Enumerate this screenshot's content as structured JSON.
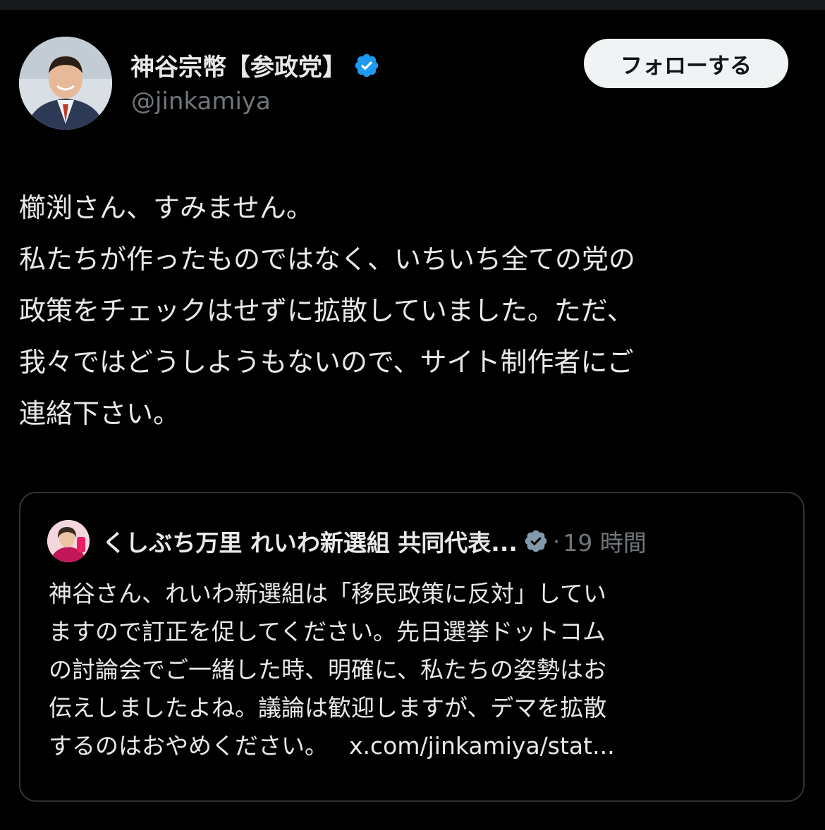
{
  "author": {
    "display_name": "神谷宗幣【参政党】",
    "handle": "@jinkamiya",
    "verified_color": "#1d9bf0"
  },
  "follow_button": {
    "label": "フォローする"
  },
  "tweet": {
    "lines": [
      "櫛渕さん、すみません。",
      "私たちが作ったものではなく、いちいち全ての党の",
      "政策をチェックはせずに拡散していました。ただ、",
      "我々ではどうしようもないので、サイト制作者にご",
      "連絡下さい。"
    ]
  },
  "quote": {
    "display_name": "くしぶち万里 れいわ新選組 共同代表...",
    "verified_color": "#829aab",
    "separator": "·",
    "time": "19 時間",
    "lines": [
      "神谷さん、れいわ新選組は「移民政策に反対」してい",
      "ますので訂正を促してください。先日選挙ドットコム",
      "の討論会でご一緒した時、明確に、私たちの姿勢はお",
      "伝えしましたよね。議論は歓迎しますが、デマを拡散",
      "するのはおやめください。"
    ],
    "link": "x.com/jinkamiya/stat..."
  },
  "colors": {
    "background": "#000000",
    "text_primary": "#e7e9ea",
    "text_secondary": "#71767b",
    "border": "#2f3336",
    "button_bg": "#eff3f4"
  }
}
